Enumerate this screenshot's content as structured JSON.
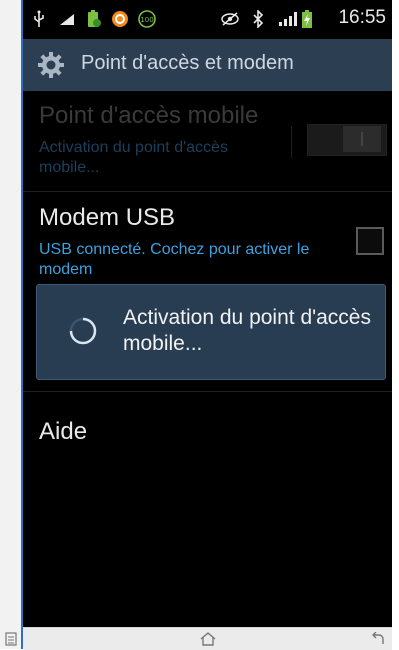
{
  "status_bar": {
    "time": "16:55",
    "icons": [
      "usb-icon",
      "signal-bars-icon",
      "battery-app-icon",
      "orange-app-icon",
      "battery-100-icon",
      "eye-off-icon",
      "bluetooth-icon",
      "cellular-signal-icon",
      "battery-charging-icon"
    ],
    "battery_badge": "100"
  },
  "action_bar": {
    "title": "Point d'accès et modem",
    "icon": "settings-gear-icon"
  },
  "list": {
    "hotspot": {
      "title": "Point d'accès mobile",
      "subtitle": "Activation du point d'accès mobile..."
    },
    "usb_modem": {
      "title": "Modem USB",
      "subtitle": "USB connecté. Cochez pour activer le modem"
    },
    "help": {
      "title": "Aide"
    }
  },
  "dialog": {
    "message": "Activation du point d'accès mobile..."
  },
  "nav_bar": {
    "icons": [
      "menu-icon",
      "home-icon",
      "back-icon"
    ]
  },
  "colors": {
    "action_bar_bg": "#2b3e52",
    "accent_blue": "#3aa2e0",
    "dialog_bg": "#283c52"
  }
}
